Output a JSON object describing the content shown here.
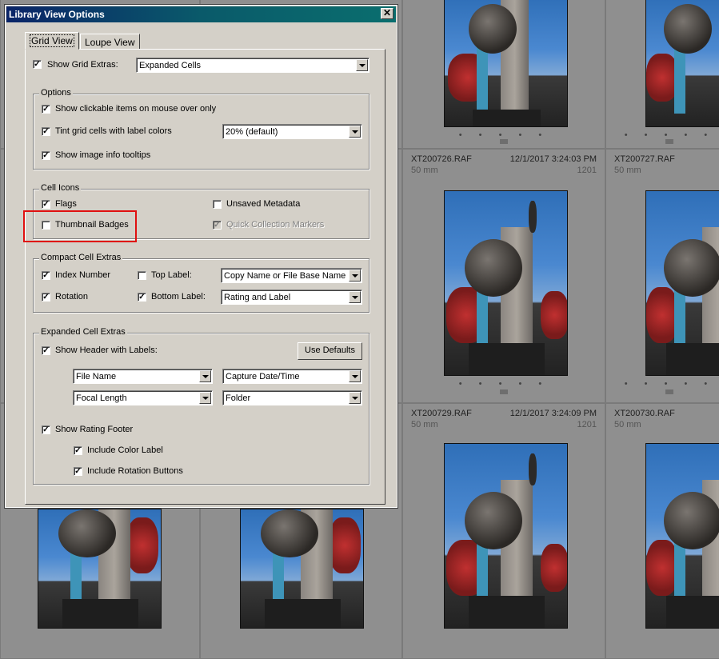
{
  "window": {
    "title": "Library View Options",
    "close_glyph": "✕"
  },
  "tabs": [
    {
      "label": "Grid View",
      "active": true
    },
    {
      "label": "Loupe View",
      "active": false
    }
  ],
  "grid_extras": {
    "label": "Show Grid Extras:",
    "checked": true,
    "value": "Expanded Cells"
  },
  "options": {
    "legend": "Options",
    "clickable": {
      "label": "Show clickable items on mouse over only",
      "checked": true
    },
    "tint": {
      "label": "Tint grid cells with label colors",
      "checked": true,
      "value": "20% (default)"
    },
    "tooltips": {
      "label": "Show image info tooltips",
      "checked": true
    }
  },
  "cell_icons": {
    "legend": "Cell Icons",
    "flags": {
      "label": "Flags",
      "checked": true
    },
    "unsaved": {
      "label": "Unsaved Metadata",
      "checked": false
    },
    "badges": {
      "label": "Thumbnail Badges",
      "checked": false
    },
    "quick": {
      "label": "Quick Collection Markers",
      "checked": true,
      "disabled": true
    }
  },
  "compact": {
    "legend": "Compact Cell Extras",
    "index": {
      "label": "Index Number",
      "checked": true
    },
    "top": {
      "label": "Top Label:",
      "checked": false,
      "value": "Copy Name or File Base Name"
    },
    "rotation": {
      "label": "Rotation",
      "checked": true
    },
    "bottom": {
      "label": "Bottom Label:",
      "checked": true,
      "value": "Rating and Label"
    }
  },
  "expanded": {
    "legend": "Expanded Cell Extras",
    "header": {
      "label": "Show Header with Labels:",
      "checked": true
    },
    "defaults_button": "Use Defaults",
    "label1": "File Name",
    "label2": "Capture Date/Time",
    "label3": "Focal Length",
    "label4": "Folder",
    "footer": {
      "label": "Show Rating Footer",
      "checked": true
    },
    "color_label": {
      "label": "Include Color Label",
      "checked": true
    },
    "rotation_buttons": {
      "label": "Include Rotation Buttons",
      "checked": true
    }
  },
  "grid_cells": {
    "row1": [
      {
        "name": "XT200726.RAF",
        "date": "12/1/2017 3:24:03 PM",
        "focal": "50 mm",
        "index": "1201"
      },
      {
        "name": "XT200727.RAF",
        "date": "",
        "focal": "50 mm",
        "index": ""
      }
    ],
    "row2": [
      {
        "name": "XT200729.RAF",
        "date": "12/1/2017 3:24:09 PM",
        "focal": "50 mm",
        "index": "1201"
      },
      {
        "name": "XT200730.RAF",
        "date": "",
        "focal": "50 mm",
        "index": ""
      }
    ],
    "dots": "• • • • •",
    "check_glyph": "✓"
  },
  "colors": {
    "highlight": "#e01010",
    "titlebar": "#0a2468",
    "dialog": "#d4d0c8"
  }
}
